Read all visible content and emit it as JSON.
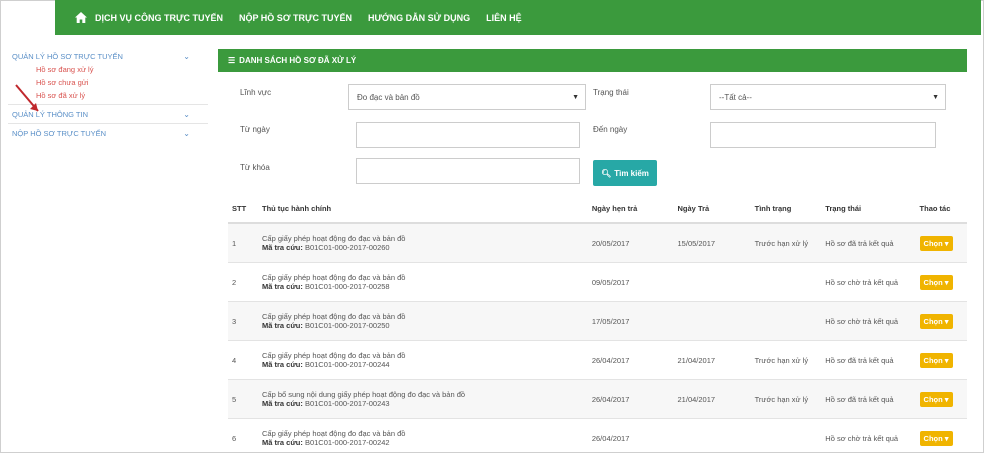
{
  "topnav": {
    "items": [
      "DỊCH VỤ CÔNG TRỰC TUYẾN",
      "NỘP HỒ SƠ TRỰC TUYẾN",
      "HƯỚNG DẪN SỬ DỤNG",
      "LIÊN HỆ"
    ]
  },
  "sidebar": {
    "section1": "QUẢN LÝ HỒ SƠ TRỰC TUYẾN",
    "sub": [
      "Hồ sơ đang xử lý",
      "Hồ sơ chưa gửi",
      "Hồ sơ đã xử lý"
    ],
    "section2": "QUẢN LÝ THÔNG TIN",
    "section3": "NỘP HỒ SƠ TRỰC TUYẾN"
  },
  "panel": {
    "title": "DANH SÁCH HỒ SƠ ĐÃ XỬ LÝ"
  },
  "filters": {
    "linhvuc_label": "Lĩnh vực",
    "linhvuc_value": "Đo đạc và bản đồ",
    "trangthai_label": "Trạng thái",
    "trangthai_value": "--Tất cả--",
    "tungay_label": "Từ ngày",
    "denngay_label": "Đến ngày",
    "tukhoa_label": "Từ khóa",
    "search_label": "Tìm kiếm"
  },
  "table": {
    "headers": [
      "STT",
      "Thủ tục hành chính",
      "Ngày hẹn trả",
      "Ngày Trả",
      "Tình trạng",
      "Trạng thái",
      "Thao tác"
    ],
    "code_label": "Mã tra cứu:",
    "action_label": "Chọn",
    "rows": [
      {
        "stt": "1",
        "name": "Cấp giấy phép hoạt động đo đạc và bản đồ",
        "code": "B01C01-000-2017-00260",
        "hen": "20/05/2017",
        "tra": "15/05/2017",
        "tinhtrang": "Trước hạn xử lý",
        "trangthai": "Hồ sơ đã trả kết quả"
      },
      {
        "stt": "2",
        "name": "Cấp giấy phép hoạt động đo đạc và bản đồ",
        "code": "B01C01-000-2017-00258",
        "hen": "09/05/2017",
        "tra": "",
        "tinhtrang": "",
        "trangthai": "Hồ sơ chờ trả kết quả"
      },
      {
        "stt": "3",
        "name": "Cấp giấy phép hoạt động đo đạc và bản đồ",
        "code": "B01C01-000-2017-00250",
        "hen": "17/05/2017",
        "tra": "",
        "tinhtrang": "",
        "trangthai": "Hồ sơ chờ trả kết quả"
      },
      {
        "stt": "4",
        "name": "Cấp giấy phép hoạt động đo đạc và bản đồ",
        "code": "B01C01-000-2017-00244",
        "hen": "26/04/2017",
        "tra": "21/04/2017",
        "tinhtrang": "Trước hạn xử lý",
        "trangthai": "Hồ sơ đã trả kết quả"
      },
      {
        "stt": "5",
        "name": "Cấp bổ sung nội dung giấy phép hoạt động đo đạc và bản đồ",
        "code": "B01C01-000-2017-00243",
        "hen": "26/04/2017",
        "tra": "21/04/2017",
        "tinhtrang": "Trước hạn xử lý",
        "trangthai": "Hồ sơ đã trả kết quả"
      },
      {
        "stt": "6",
        "name": "Cấp giấy phép hoạt động đo đạc và bản đồ",
        "code": "B01C01-000-2017-00242",
        "hen": "26/04/2017",
        "tra": "",
        "tinhtrang": "",
        "trangthai": "Hồ sơ chờ trả kết quả"
      }
    ]
  }
}
